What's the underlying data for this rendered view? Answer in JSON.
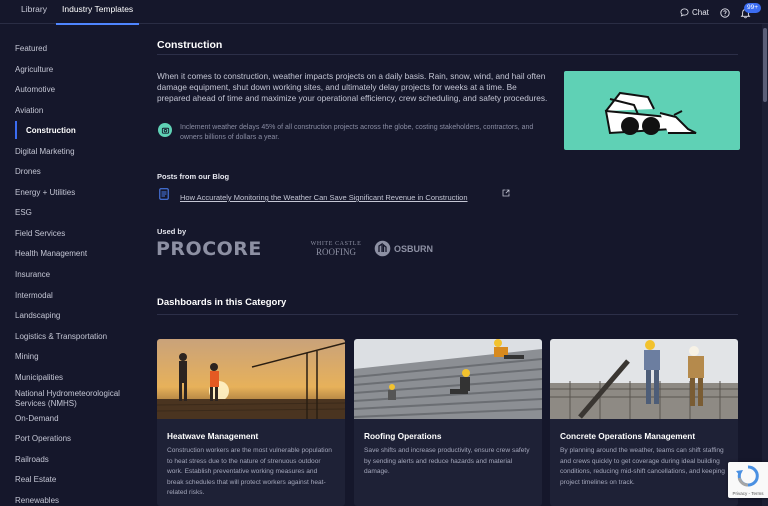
{
  "tabs": [
    {
      "label": "Library"
    },
    {
      "label": "Industry Templates"
    }
  ],
  "header": {
    "chat_label": "Chat",
    "notification_count": "99+"
  },
  "sidebar": {
    "items": [
      {
        "label": "Featured"
      },
      {
        "label": "Agriculture"
      },
      {
        "label": "Automotive"
      },
      {
        "label": "Aviation"
      },
      {
        "label": "Construction"
      },
      {
        "label": "Digital Marketing"
      },
      {
        "label": "Drones"
      },
      {
        "label": "Energy + Utilities"
      },
      {
        "label": "ESG"
      },
      {
        "label": "Field Services"
      },
      {
        "label": "Health Management"
      },
      {
        "label": "Insurance"
      },
      {
        "label": "Intermodal"
      },
      {
        "label": "Landscaping"
      },
      {
        "label": "Logistics & Transportation"
      },
      {
        "label": "Mining"
      },
      {
        "label": "Municipalities"
      },
      {
        "label": "National Hydrometeorological Services (NMHS)"
      },
      {
        "label": "On-Demand"
      },
      {
        "label": "Port Operations"
      },
      {
        "label": "Railroads"
      },
      {
        "label": "Real Estate"
      },
      {
        "label": "Renewables"
      }
    ],
    "active_index": 4
  },
  "main": {
    "title": "Construction",
    "intro": "When it comes to construction, weather impacts projects on a daily basis. Rain, snow, wind, and hail often damage equipment, shut down working sites, and ultimately delay projects for weeks at a time. Be prepared ahead of time and maximize your operational efficiency, crew scheduling, and safety procedures.",
    "stat": "Inclement weather delays 45% of all construction projects across the globe, costing stakeholders, contractors, and owners billions of dollars a year.",
    "blog": {
      "label": "Posts from our Blog",
      "link": "How Accurately Monitoring the Weather Can Save Significant Revenue in Construction"
    },
    "used_by": {
      "label": "Used by",
      "logos": {
        "procore": "PROCORE",
        "white_castle_1": "WHITE CASTLE",
        "white_castle_2": "ROOFING",
        "osburn": "OSBURN"
      }
    },
    "dashboards_title": "Dashboards in this Category",
    "cards": [
      {
        "title": "Heatwave Management",
        "desc": "Construction workers are the most vulnerable population to heat stress due to the nature of strenuous outdoor work. Establish preventative working measures and break schedules that will protect workers against heat-related risks."
      },
      {
        "title": "Roofing Operations",
        "desc": "Save shifts and increase productivity, ensure crew safety by sending alerts and reduce hazards and material damage."
      },
      {
        "title": "Concrete Operations Management",
        "desc": "By planning around the weather, teams can shift staffing and crews quickly to get coverage during ideal building conditions, reducing mid-shift cancellations, and keeping project timelines on track."
      }
    ]
  },
  "recaptcha": {
    "text": "Privacy - Terms"
  },
  "colors": {
    "background": "#15172b",
    "accent": "#3b6cf0",
    "hero": "#5fd1b5",
    "card": "#1e2136"
  }
}
